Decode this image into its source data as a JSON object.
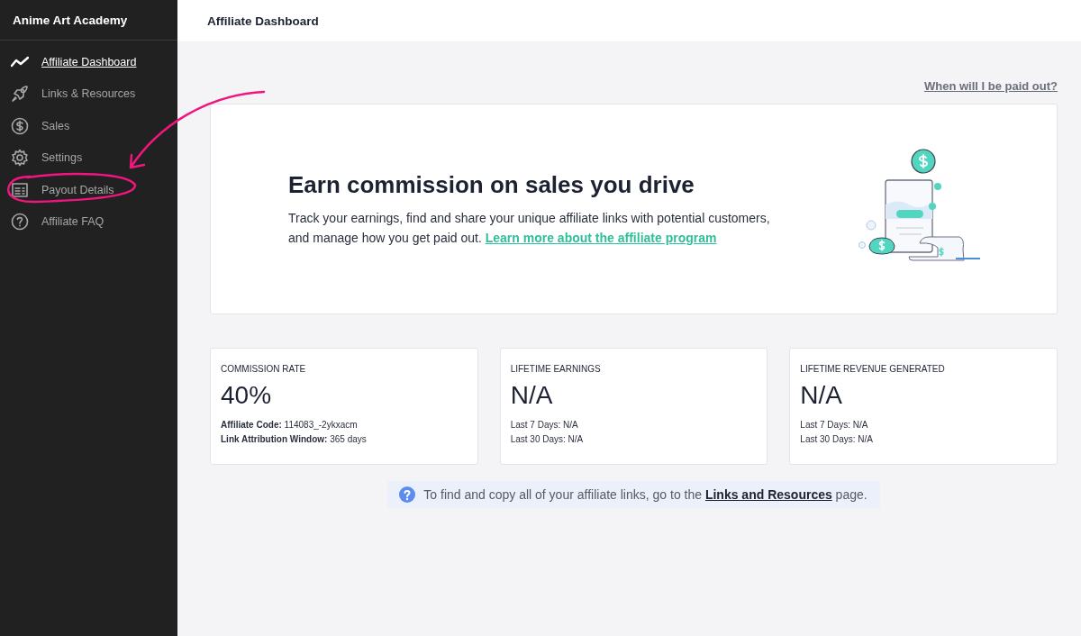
{
  "sidebar": {
    "title": "Anime Art Academy",
    "items": [
      {
        "label": "Affiliate Dashboard",
        "selected": true
      },
      {
        "label": "Links & Resources",
        "selected": false
      },
      {
        "label": "Sales",
        "selected": false
      },
      {
        "label": "Settings",
        "selected": false
      },
      {
        "label": "Payout Details",
        "selected": false
      },
      {
        "label": "Affiliate FAQ",
        "selected": false
      }
    ]
  },
  "header": {
    "title": "Affiliate Dashboard"
  },
  "payout_link": "When will I be paid out?",
  "hero": {
    "heading": "Earn commission on sales you drive",
    "text": "Track your earnings, find and share your unique affiliate links with potential customers, and manage how you get paid out.",
    "link": "Learn more about the affiliate program"
  },
  "stats": [
    {
      "label": "COMMISSION RATE",
      "value": "40%",
      "details": [
        "**Affiliate Code:** 114083_-2ykxacm",
        "**Link Attribution Window:** 365 days"
      ]
    },
    {
      "label": "LIFETIME EARNINGS",
      "value": "N/A",
      "details": [
        "Last 7 Days: N/A",
        "Last 30 Days: N/A"
      ]
    },
    {
      "label": "LIFETIME REVENUE GENERATED",
      "value": "N/A",
      "details": [
        "Last 7 Days: N/A",
        "Last 30 Days: N/A"
      ]
    }
  ],
  "info": {
    "before": "To find and copy all of your affiliate links, go to the",
    "link": "Links and Resources",
    "after": "page."
  }
}
